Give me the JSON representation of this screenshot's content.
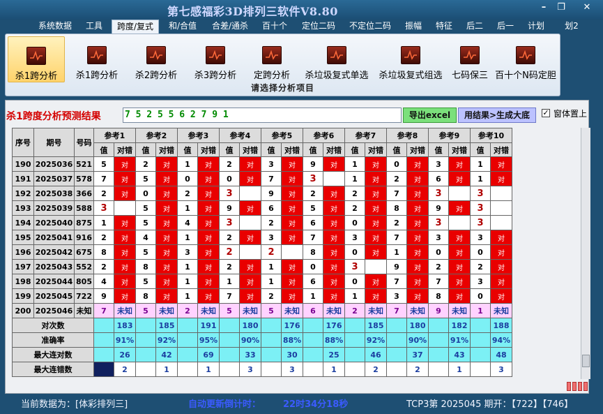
{
  "app": {
    "title": "第七感福彩3D排列三软件V8.80"
  },
  "window_controls": {
    "minimize": "–",
    "maximize": "❐",
    "close": "✕"
  },
  "menu": [
    "系统数据",
    "工具",
    "跨度/复式",
    "和/合值",
    "合差/通杀",
    "百十个",
    "定位二码",
    "不定位二码",
    "振幅",
    "特征",
    "后二",
    "后一",
    "计划",
    "划2"
  ],
  "ribbon": {
    "buttons": [
      "杀1跨分析",
      "杀1跨分析",
      "杀2跨分析",
      "杀3跨分析",
      "定跨分析",
      "杀垃圾复式单选",
      "杀垃圾复式组选",
      "七码保三",
      "百十个N码定胆"
    ],
    "group_label": "请选择分析项目"
  },
  "result": {
    "label": "杀1跨度分析预测结果",
    "value": "7 5 2 5 5 6 2 7 9 1",
    "export_button": "导出excel",
    "generate_button": "用结果>生成大底",
    "checkbox_label": "窗体置上",
    "checkbox_mark": "✓"
  },
  "table": {
    "col_serial": "序号",
    "col_period": "期号",
    "col_number": "号码",
    "refs": [
      "参考1",
      "参考2",
      "参考3",
      "参考4",
      "参考5",
      "参考6",
      "参考7",
      "参考8",
      "参考9",
      "参考10"
    ],
    "sub_value": "值",
    "sub_result": "对错",
    "ok_text": "对",
    "unknown_text": "未知",
    "rows": [
      {
        "no": "190",
        "period": "2025036",
        "number": "521",
        "cells": [
          [
            "5",
            1
          ],
          [
            "2",
            1
          ],
          [
            "1",
            1
          ],
          [
            "2",
            1
          ],
          [
            "3",
            1
          ],
          [
            "9",
            1
          ],
          [
            "1",
            1
          ],
          [
            "0",
            1
          ],
          [
            "3",
            1
          ],
          [
            "1",
            1
          ]
        ]
      },
      {
        "no": "191",
        "period": "2025037",
        "number": "578",
        "cells": [
          [
            "7",
            1
          ],
          [
            "5",
            1
          ],
          [
            "0",
            1
          ],
          [
            "0",
            1
          ],
          [
            "7",
            1
          ],
          [
            "3",
            0
          ],
          [
            "1",
            1
          ],
          [
            "2",
            1
          ],
          [
            "6",
            1
          ],
          [
            "1",
            1
          ]
        ]
      },
      {
        "no": "192",
        "period": "2025038",
        "number": "366",
        "cells": [
          [
            "2",
            1
          ],
          [
            "0",
            1
          ],
          [
            "2",
            1
          ],
          [
            "3",
            0
          ],
          [
            "9",
            1
          ],
          [
            "2",
            1
          ],
          [
            "2",
            1
          ],
          [
            "7",
            1
          ],
          [
            "3",
            0
          ],
          [
            "3",
            0
          ]
        ]
      },
      {
        "no": "193",
        "period": "2025039",
        "number": "588",
        "cells": [
          [
            "3",
            0
          ],
          [
            "5",
            1
          ],
          [
            "1",
            1
          ],
          [
            "9",
            1
          ],
          [
            "6",
            1
          ],
          [
            "5",
            1
          ],
          [
            "2",
            1
          ],
          [
            "8",
            1
          ],
          [
            "9",
            1
          ],
          [
            "3",
            0
          ]
        ]
      },
      {
        "no": "194",
        "period": "2025040",
        "number": "875",
        "cells": [
          [
            "1",
            1
          ],
          [
            "5",
            1
          ],
          [
            "4",
            1
          ],
          [
            "3",
            0
          ],
          [
            "2",
            1
          ],
          [
            "6",
            1
          ],
          [
            "0",
            1
          ],
          [
            "2",
            1
          ],
          [
            "3",
            0
          ],
          [
            "3",
            0
          ]
        ]
      },
      {
        "no": "195",
        "period": "2025041",
        "number": "916",
        "cells": [
          [
            "2",
            1
          ],
          [
            "4",
            1
          ],
          [
            "1",
            1
          ],
          [
            "2",
            1
          ],
          [
            "3",
            1
          ],
          [
            "7",
            1
          ],
          [
            "3",
            1
          ],
          [
            "7",
            1
          ],
          [
            "3",
            1
          ],
          [
            "3",
            1
          ]
        ]
      },
      {
        "no": "196",
        "period": "2025042",
        "number": "675",
        "cells": [
          [
            "8",
            1
          ],
          [
            "5",
            1
          ],
          [
            "3",
            1
          ],
          [
            "2",
            0
          ],
          [
            "2",
            0
          ],
          [
            "8",
            1
          ],
          [
            "0",
            1
          ],
          [
            "1",
            1
          ],
          [
            "0",
            1
          ],
          [
            "0",
            1
          ]
        ]
      },
      {
        "no": "197",
        "period": "2025043",
        "number": "552",
        "cells": [
          [
            "2",
            1
          ],
          [
            "8",
            1
          ],
          [
            "1",
            1
          ],
          [
            "2",
            1
          ],
          [
            "1",
            1
          ],
          [
            "0",
            1
          ],
          [
            "3",
            0
          ],
          [
            "9",
            1
          ],
          [
            "2",
            1
          ],
          [
            "2",
            1
          ]
        ]
      },
      {
        "no": "198",
        "period": "2025044",
        "number": "805",
        "cells": [
          [
            "4",
            1
          ],
          [
            "5",
            1
          ],
          [
            "1",
            1
          ],
          [
            "1",
            1
          ],
          [
            "1",
            1
          ],
          [
            "6",
            1
          ],
          [
            "0",
            1
          ],
          [
            "7",
            1
          ],
          [
            "7",
            1
          ],
          [
            "3",
            1
          ]
        ]
      },
      {
        "no": "199",
        "period": "2025045",
        "number": "722",
        "cells": [
          [
            "9",
            1
          ],
          [
            "8",
            1
          ],
          [
            "1",
            1
          ],
          [
            "7",
            1
          ],
          [
            "2",
            1
          ],
          [
            "1",
            1
          ],
          [
            "1",
            1
          ],
          [
            "3",
            1
          ],
          [
            "8",
            1
          ],
          [
            "0",
            1
          ]
        ]
      }
    ],
    "prediction_row": {
      "no": "200",
      "period": "2025046",
      "number": "未知",
      "values": [
        "7",
        "5",
        "2",
        "5",
        "5",
        "6",
        "2",
        "7",
        "9",
        "1"
      ]
    },
    "stats": [
      {
        "label": "对次数",
        "values": [
          "183",
          "185",
          "191",
          "180",
          "176",
          "176",
          "185",
          "180",
          "182",
          "188"
        ]
      },
      {
        "label": "准确率",
        "values": [
          "91%",
          "92%",
          "95%",
          "90%",
          "88%",
          "88%",
          "92%",
          "90%",
          "91%",
          "94%"
        ]
      },
      {
        "label": "最大连对数",
        "values": [
          "26",
          "42",
          "69",
          "33",
          "30",
          "25",
          "46",
          "37",
          "43",
          "48"
        ]
      },
      {
        "label": "最大连错数",
        "values": [
          "2",
          "1",
          "1",
          "3",
          "3",
          "1",
          "2",
          "2",
          "1",
          "3"
        ]
      }
    ]
  },
  "status": {
    "current_data_label": "当前数据为：[体彩排列三]",
    "countdown_label": "自动更新倒计时：",
    "countdown_value": "22时34分18秒",
    "draw_info": "TCP3第 2025045 期开：【722】【746】"
  },
  "colors": {
    "ok": "#e90000",
    "prediction": "#ffd2ff",
    "stats": "#7cf0f5",
    "status_blue": "#3b5bff"
  }
}
